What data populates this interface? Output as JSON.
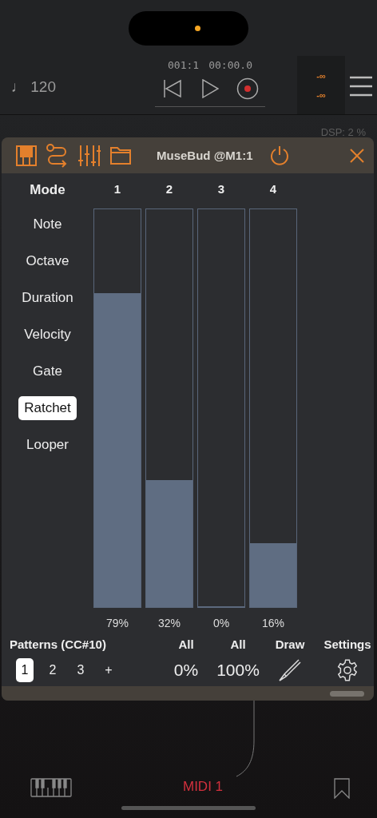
{
  "transport": {
    "tempo": "♩ 120",
    "position": "001:1",
    "time": "00:00.0",
    "meter": [
      "-∞",
      "-∞"
    ],
    "dsp": "DSP: 2 %"
  },
  "plugin": {
    "title": "MuseBud @M1:1",
    "mode_heading": "Mode",
    "modes": [
      {
        "label": "Note",
        "selected": false
      },
      {
        "label": "Octave",
        "selected": false
      },
      {
        "label": "Duration",
        "selected": false
      },
      {
        "label": "Velocity",
        "selected": false
      },
      {
        "label": "Gate",
        "selected": false
      },
      {
        "label": "Ratchet",
        "selected": true
      },
      {
        "label": "Looper",
        "selected": false
      }
    ],
    "channels": [
      {
        "label": "1",
        "level": 0.79,
        "reading": "79%"
      },
      {
        "label": "2",
        "level": 0.32,
        "reading": "32%"
      },
      {
        "label": "3",
        "level": 0,
        "reading": "0%"
      },
      {
        "label": "4",
        "level": 0.16,
        "reading": "16%"
      }
    ],
    "patterns": {
      "title": "Patterns (CC#10)",
      "items": [
        {
          "label": "1",
          "selected": true
        },
        {
          "label": "2",
          "selected": false
        },
        {
          "label": "3",
          "selected": false
        }
      ],
      "add": "+"
    },
    "controls": [
      {
        "kind": "value",
        "label": "All",
        "value": "0%"
      },
      {
        "kind": "value",
        "label": "All",
        "value": "100%"
      },
      {
        "kind": "draw",
        "label": "Draw"
      },
      {
        "kind": "settings",
        "label": "Settings"
      }
    ]
  },
  "footer": {
    "track": "MIDI 1"
  }
}
